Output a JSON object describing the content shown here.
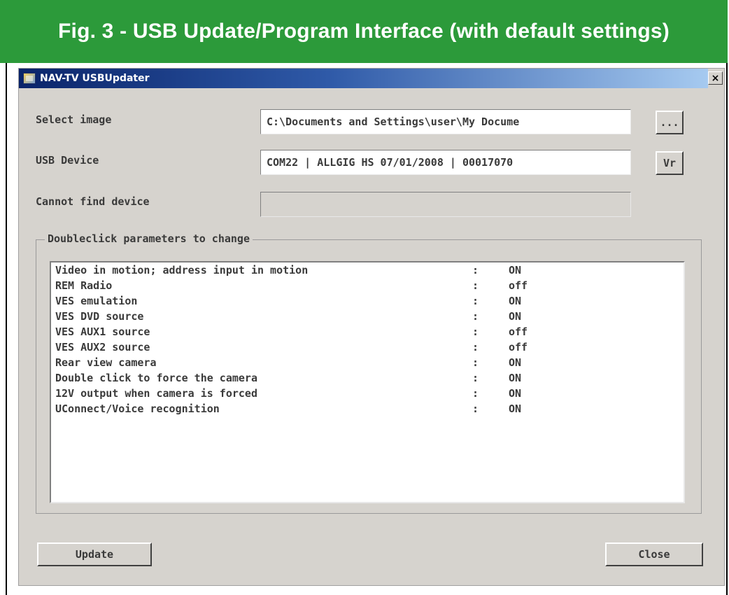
{
  "figure": {
    "title": "Fig. 3 - USB Update/Program Interface (with default settings)"
  },
  "window": {
    "title": "NAV-TV USBUpdater",
    "close_label": "×"
  },
  "form": {
    "select_image_label": "Select image",
    "select_image_value": "C:\\Documents and Settings\\user\\My Docume",
    "browse_label": "...",
    "usb_device_label": "USB Device",
    "usb_device_value": "COM22 | ALLGIG HS 07/01/2008 | 00017070",
    "ver_label": "Vr",
    "status_label": "Cannot find device",
    "status_value": ""
  },
  "params": {
    "group_label": "Doubleclick parameters to change",
    "items": [
      {
        "name": "Video in motion; address input in motion",
        "sep": ":",
        "value": "ON"
      },
      {
        "name": "REM Radio",
        "sep": ":",
        "value": "off"
      },
      {
        "name": "VES emulation",
        "sep": ":",
        "value": "ON"
      },
      {
        "name": "VES DVD source",
        "sep": ":",
        "value": "ON"
      },
      {
        "name": "VES AUX1 source",
        "sep": ":",
        "value": "off"
      },
      {
        "name": "VES AUX2 source",
        "sep": ":",
        "value": "off"
      },
      {
        "name": "Rear view camera",
        "sep": ":",
        "value": "ON"
      },
      {
        "name": "Double click to force the camera",
        "sep": ":",
        "value": "ON"
      },
      {
        "name": "12V output when camera is forced",
        "sep": ":",
        "value": "ON"
      },
      {
        "name": "UConnect/Voice recognition",
        "sep": ":",
        "value": "ON"
      }
    ]
  },
  "actions": {
    "update_label": "Update",
    "close_label": "Close"
  },
  "colors": {
    "header_green": "#2c9a3a",
    "window_gray": "#d6d3ce",
    "titlebar_blue": "#0a246a"
  },
  "icons": {
    "app": "usb-updater-app-icon",
    "close": "close-icon"
  }
}
